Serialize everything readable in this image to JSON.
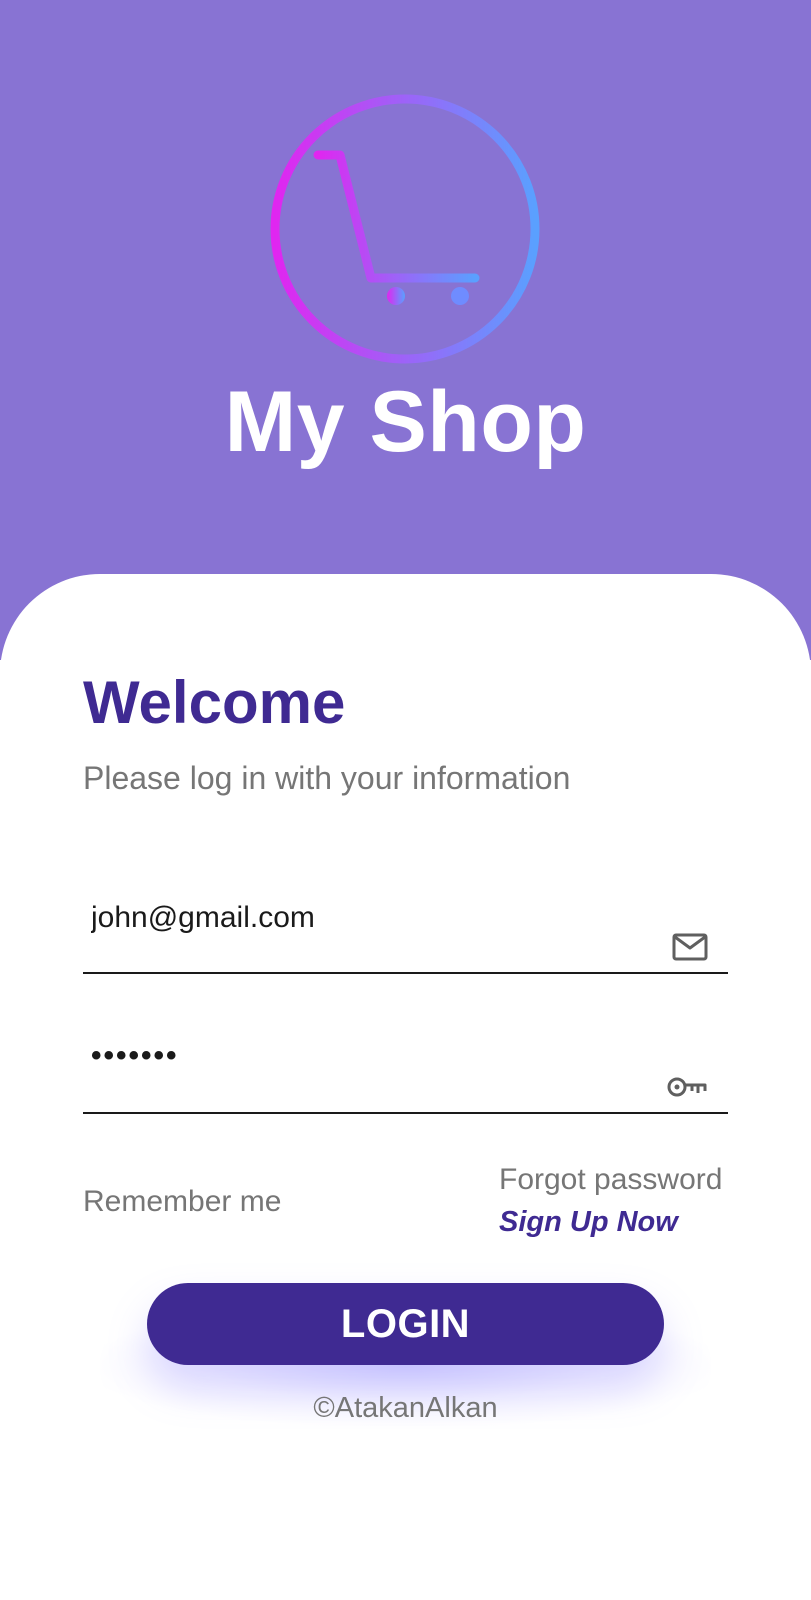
{
  "app": {
    "title": "My Shop",
    "logo_icon": "shopping-cart-icon"
  },
  "login": {
    "heading": "Welcome",
    "subtitle": "Please log in with your information",
    "email": {
      "value": "john@gmail.com",
      "icon": "mail-icon"
    },
    "password": {
      "value": "•••••••",
      "icon": "key-icon"
    },
    "remember_label": "Remember me",
    "forgot_label": "Forgot password",
    "signup_label": "Sign Up Now",
    "login_label": "LOGIN",
    "copyright": "©AtakanAlkan"
  },
  "colors": {
    "header_bg": "#8873d3",
    "primary": "#3f2a92",
    "logo_gradient_start": "#e026f0",
    "logo_gradient_end": "#5aa0ff"
  }
}
